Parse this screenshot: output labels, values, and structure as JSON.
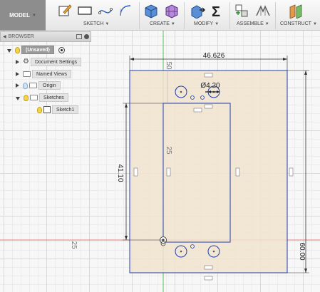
{
  "toolbar": {
    "workspace": "MODEL",
    "groups": [
      {
        "label": "SKETCH"
      },
      {
        "label": "CREATE"
      },
      {
        "label": "MODIFY"
      },
      {
        "label": "ASSEMBLE"
      },
      {
        "label": "CONSTRUCT"
      }
    ],
    "icons": [
      "sketch-create-icon",
      "rectangle-icon",
      "spline-icon",
      "arc-icon",
      "box-icon",
      "grid-box-icon",
      "push-pull-icon",
      "sigma-icon",
      "joint-icon",
      "as-built-joint-icon",
      "offset-plane-icon"
    ]
  },
  "browser": {
    "title": "BROWSER",
    "root": "(Unsaved)",
    "items": [
      {
        "label": "Document Settings"
      },
      {
        "label": "Named Views"
      },
      {
        "label": "Origin"
      },
      {
        "label": "Sketches"
      },
      {
        "label": "Sketch1"
      }
    ]
  },
  "dimensions": {
    "width_top": "46.626",
    "diameter": "Ø4.20",
    "left_height": "41.10",
    "right_height": "60.00",
    "top_offset": "50",
    "inner_offset": "25",
    "left_offset": "25"
  },
  "colors": {
    "sketch_line": "#1f3fb0",
    "sketch_fill": "#f1e3cf",
    "axis_green": "#5cbf5c",
    "axis_red": "#e07a7a",
    "dim_line": "#333333"
  }
}
